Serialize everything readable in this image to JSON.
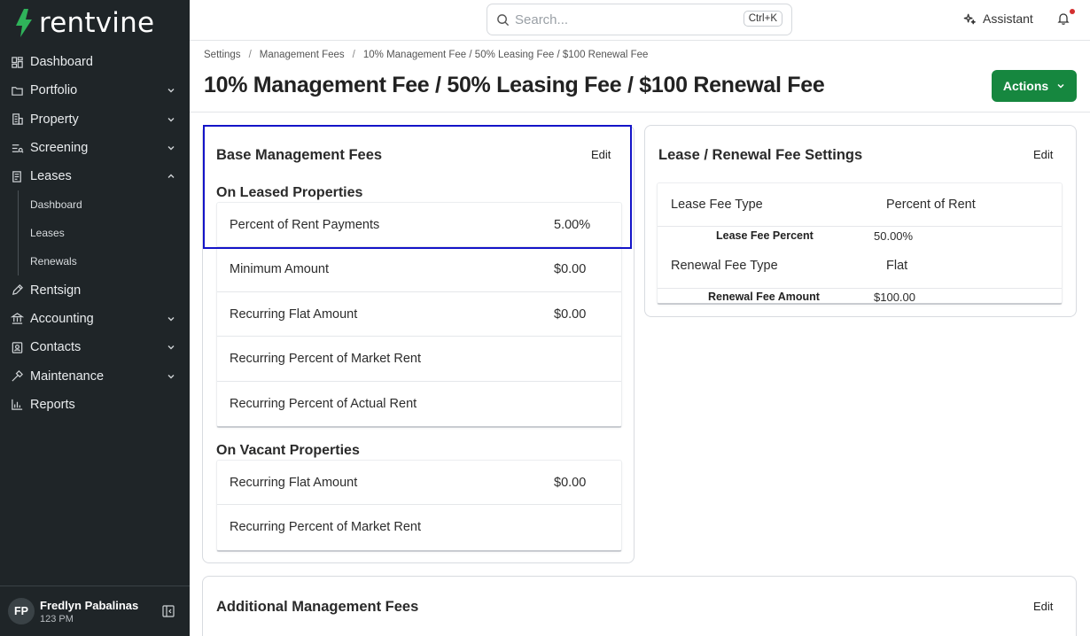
{
  "app": {
    "logo_text": "rentvine"
  },
  "sidebar": {
    "items": [
      {
        "label": "Dashboard"
      },
      {
        "label": "Portfolio"
      },
      {
        "label": "Property"
      },
      {
        "label": "Screening"
      },
      {
        "label": "Leases"
      },
      {
        "label": "Rentsign"
      },
      {
        "label": "Accounting"
      },
      {
        "label": "Contacts"
      },
      {
        "label": "Maintenance"
      },
      {
        "label": "Reports"
      }
    ],
    "leases_sub": [
      {
        "label": "Dashboard"
      },
      {
        "label": "Leases"
      },
      {
        "label": "Renewals"
      }
    ],
    "user": {
      "initials": "FP",
      "name": "Fredlyn Pabalinas",
      "sub": "123 PM"
    }
  },
  "topbar": {
    "search_placeholder": "Search...",
    "search_shortcut": "Ctrl+K",
    "assistant_label": "Assistant"
  },
  "header": {
    "breadcrumb": [
      "Settings",
      "Management Fees",
      "10% Management Fee / 50% Leasing Fee / $100 Renewal Fee"
    ],
    "title": "10% Management Fee / 50% Leasing Fee / $100 Renewal Fee",
    "actions_label": "Actions"
  },
  "base_fees": {
    "title": "Base Management Fees",
    "edit_label": "Edit",
    "leased_title": "On Leased Properties",
    "leased_rows": [
      {
        "label": "Percent of Rent Payments",
        "value": "5.00%"
      },
      {
        "label": "Minimum Amount",
        "value": "$0.00"
      },
      {
        "label": "Recurring Flat Amount",
        "value": "$0.00"
      },
      {
        "label": "Recurring Percent of Market Rent",
        "value": ""
      },
      {
        "label": "Recurring Percent of Actual Rent",
        "value": ""
      }
    ],
    "vacant_title": "On Vacant Properties",
    "vacant_rows": [
      {
        "label": "Recurring Flat Amount",
        "value": "$0.00"
      },
      {
        "label": "Recurring Percent of Market Rent",
        "value": ""
      }
    ]
  },
  "lease_renewal": {
    "title": "Lease / Renewal Fee Settings",
    "edit_label": "Edit",
    "lease_fee_type_label": "Lease Fee Type",
    "lease_fee_type_value": "Percent of Rent",
    "lease_fee_percent_label": "Lease Fee Percent",
    "lease_fee_percent_value": "50.00%",
    "renewal_fee_type_label": "Renewal Fee Type",
    "renewal_fee_type_value": "Flat",
    "renewal_fee_amount_label": "Renewal Fee Amount",
    "renewal_fee_amount_value": "$100.00"
  },
  "additional_fees": {
    "title": "Additional Management Fees",
    "edit_label": "Edit"
  },
  "colors": {
    "sidebar_bg": "#1f2528",
    "brand_green": "#16873f",
    "highlight_border": "#1414c8"
  }
}
